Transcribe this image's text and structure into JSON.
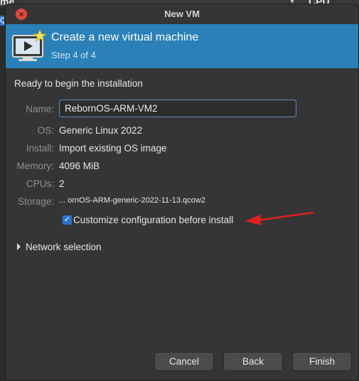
{
  "background": {
    "left_text": "me",
    "right_text": "CPU usage",
    "caret": "▾",
    "selected_char": "Q"
  },
  "window": {
    "title": "New VM"
  },
  "banner": {
    "title": "Create a new virtual machine",
    "step": "Step 4 of 4"
  },
  "content": {
    "heading": "Ready to begin the installation",
    "fields": {
      "name": {
        "label": "Name:",
        "value": "RebornOS-ARM-VM2"
      },
      "os": {
        "label": "OS:",
        "value": "Generic Linux 2022"
      },
      "install": {
        "label": "Install:",
        "value": "Import existing OS image"
      },
      "memory": {
        "label": "Memory:",
        "value": "4096 MiB"
      },
      "cpus": {
        "label": "CPUs:",
        "value": "2"
      },
      "storage": {
        "label": "Storage:",
        "value": "...  ornOS-ARM-generic-2022-11-13.qcow2"
      }
    },
    "customize": {
      "label": "Customize configuration before install",
      "checked": true
    },
    "network": {
      "label": "Network selection"
    }
  },
  "buttons": {
    "cancel": "Cancel",
    "back": "Back",
    "finish": "Finish"
  },
  "colors": {
    "banner": "#2a80b7",
    "accent": "#2f74c9",
    "annotation_arrow": "#e02020",
    "close": "#e0483e"
  }
}
